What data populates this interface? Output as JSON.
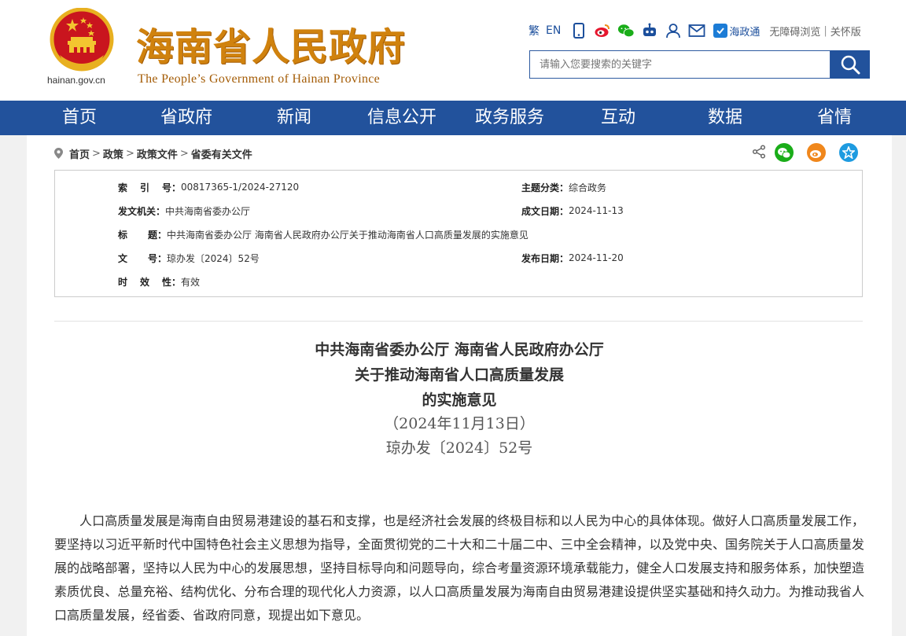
{
  "header": {
    "logo_domain": "hainan.gov.cn",
    "logo_cn": "海南省人民政府",
    "logo_en": "The People’s Government  of Hainan Province",
    "toolbar": {
      "traditional": "繁",
      "english": "EN",
      "hzt_label": "海政通",
      "accessible": "无障碍浏览",
      "separator": "|",
      "care": "关怀版"
    },
    "search": {
      "placeholder": "请输入您要搜索的关键字"
    }
  },
  "nav": {
    "items": [
      {
        "label": "首页"
      },
      {
        "label": "省政府"
      },
      {
        "label": "新闻"
      },
      {
        "label": "信息公开"
      },
      {
        "label": "政务服务"
      },
      {
        "label": "互动"
      },
      {
        "label": "数据"
      },
      {
        "label": "省情"
      }
    ]
  },
  "breadcrumb": {
    "items": [
      "首页",
      "政策",
      "政策文件",
      "省委有关文件"
    ],
    "sep": ">"
  },
  "meta": {
    "index_label": [
      "索",
      "引",
      "号："
    ],
    "index_value": "00817365-1/2024-27120",
    "topic_label": "主题分类：",
    "topic_value": "综合政务",
    "issuer_label": "发文机关：",
    "issuer_value": "中共海南省委办公厅",
    "date_label": "成文日期：",
    "date_value": "2024-11-13",
    "title_label": [
      "标",
      "题："
    ],
    "title_value": "中共海南省委办公厅 海南省人民政府办公厅关于推动海南省人口高质量发展的实施意见",
    "docno_label": [
      "文",
      "号："
    ],
    "docno_value": "琼办发〔2024〕52号",
    "publish_label": "发布日期：",
    "publish_value": "2024-11-20",
    "validity_label": [
      "时",
      "效",
      "性："
    ],
    "validity_value": "有效"
  },
  "document": {
    "title_line1": "中共海南省委办公厅 海南省人民政府办公厅",
    "title_line2": "关于推动海南省人口高质量发展",
    "title_line3": "的实施意见",
    "date_line": "（2024年11月13日）",
    "docno_line": "琼办发〔2024〕52号",
    "paragraph1": "人口高质量发展是海南自由贸易港建设的基石和支撑，也是经济社会发展的终极目标和以人民为中心的具体体现。做好人口高质量发展工作，要坚持以习近平新时代中国特色社会主义思想为指导，全面贯彻党的二十大和二十届二中、三中全会精神，以及党中央、国务院关于人口高质量发展的战略部署，坚持以人民为中心的发展思想，坚持目标导向和问题导向，综合考量资源环境承载能力，健全人口发展支持和服务体系，加快塑造素质优良、总量充裕、结构优化、分布合理的现代化人力资源，以人口高质量发展为海南自由贸易港建设提供坚实基础和持久动力。为推动我省人口高质量发展，经省委、省政府同意，现提出如下意见。"
  },
  "colors": {
    "brand_blue": "#22529c",
    "logo_gold": "#d0820e",
    "wechat_green": "#1aad19",
    "weibo_orange": "#f0871c",
    "favorite_blue": "#1e9be0"
  }
}
